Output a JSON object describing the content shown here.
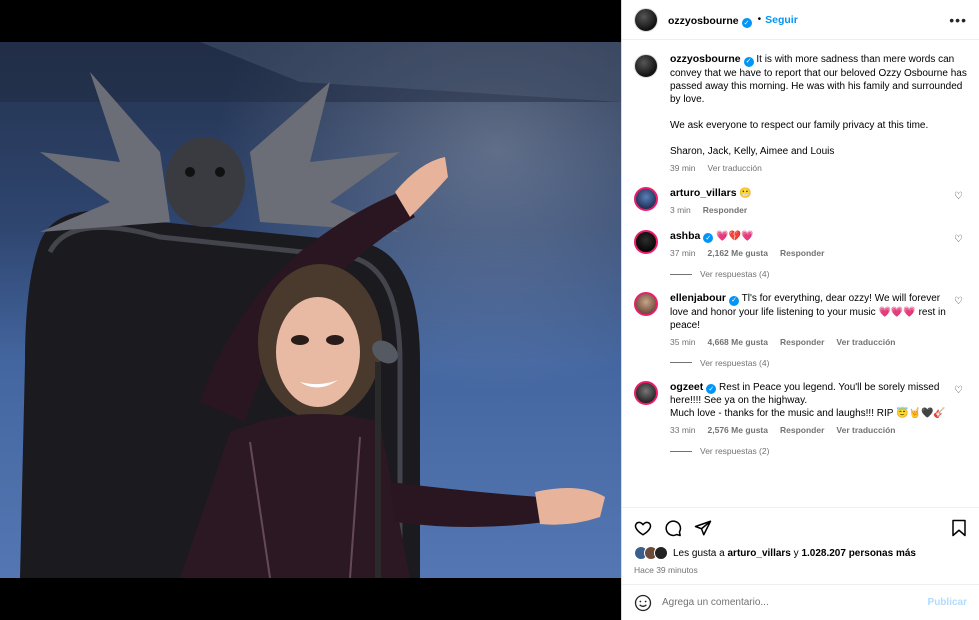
{
  "post": {
    "author": "ozzyosbourne",
    "follow_label": "Seguir",
    "more_icon": "ellipsis-icon",
    "caption_paragraphs": [
      "It is with more sadness than mere words can convey that we have to report that our beloved Ozzy Osbourne has passed away this morning. He was with his family and surrounded by love.",
      "We ask everyone to respect our family privacy at this time.",
      "Sharon, Jack, Kelly, Aimee and Louis"
    ],
    "caption_time": "39 min",
    "caption_translate": "Ver traducción"
  },
  "comments": [
    {
      "user": "arturo_villars",
      "text": "😬",
      "time": "3 min",
      "likes": "",
      "reply": "Responder",
      "translate": "",
      "replies": ""
    },
    {
      "user": "ashba",
      "text": "💗💔💗",
      "time": "37 min",
      "likes": "2,162 Me gusta",
      "reply": "Responder",
      "translate": "",
      "replies": "Ver respuestas (4)"
    },
    {
      "user": "ellenjabour",
      "text": "Tl's for everything, dear ozzy! We will forever love and honor your life listening to your music 💗💗💗 rest in peace!",
      "time": "35 min",
      "likes": "4,668 Me gusta",
      "reply": "Responder",
      "translate": "Ver traducción",
      "replies": "Ver respuestas (4)"
    },
    {
      "user": "ogzeet",
      "text": "Rest in Peace you legend. You'll be sorely missed here!!!! See ya on the highway.\nMuch love - thanks for the music and laughs!!! RIP 😇🤘🖤🎸",
      "time": "33 min",
      "likes": "2,576 Me gusta",
      "reply": "Responder",
      "translate": "Ver traducción",
      "replies": "Ver respuestas (2)"
    }
  ],
  "actions": {
    "likes_prefix": "Les gusta a",
    "likes_user": "arturo_villars",
    "likes_and": "y",
    "likes_count": "1.028.207 personas más",
    "posted_ago": "Hace 39 minutos"
  },
  "composer": {
    "placeholder": "Agrega un comentario...",
    "publish_label": "Publicar"
  },
  "colors": {
    "accent": "#0095f6",
    "heart": "#ed4956"
  }
}
